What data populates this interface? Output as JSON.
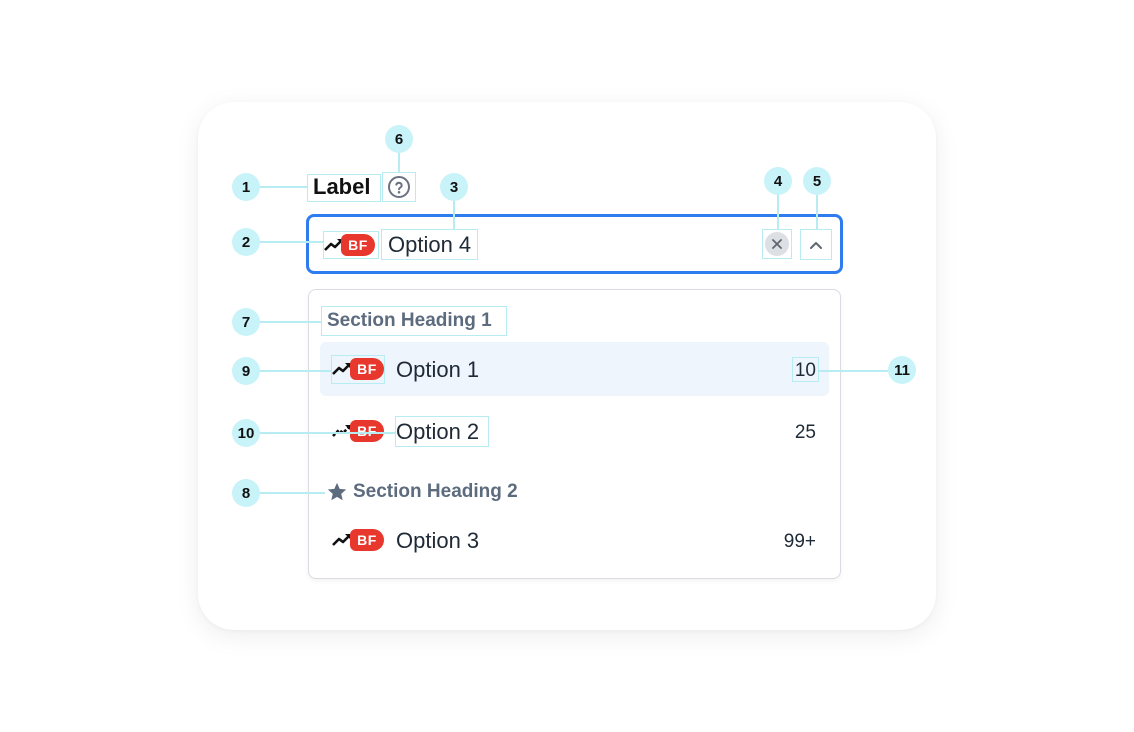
{
  "field": {
    "label": "Label",
    "value": "Option 4",
    "badge": "BF"
  },
  "menu": {
    "sections": [
      {
        "heading": "Section Heading 1",
        "items": [
          {
            "label": "Option 1",
            "badge": "BF",
            "count": "10",
            "active": true
          },
          {
            "label": "Option 2",
            "badge": "BF",
            "count": "25",
            "active": false
          }
        ]
      },
      {
        "heading": "Section Heading 2",
        "icon": "star-icon",
        "items": [
          {
            "label": "Option 3",
            "badge": "BF",
            "count": "99+",
            "active": false
          }
        ]
      }
    ]
  },
  "annotations": [
    "1",
    "2",
    "3",
    "4",
    "5",
    "6",
    "7",
    "8",
    "9",
    "10",
    "11"
  ],
  "colors": {
    "focus_border": "#2f7cf0",
    "badge_red": "#e8372c",
    "annotation_marker": "#c8f3f8",
    "active_row": "#eef5fd",
    "heading_gray": "#5d6b7e"
  }
}
